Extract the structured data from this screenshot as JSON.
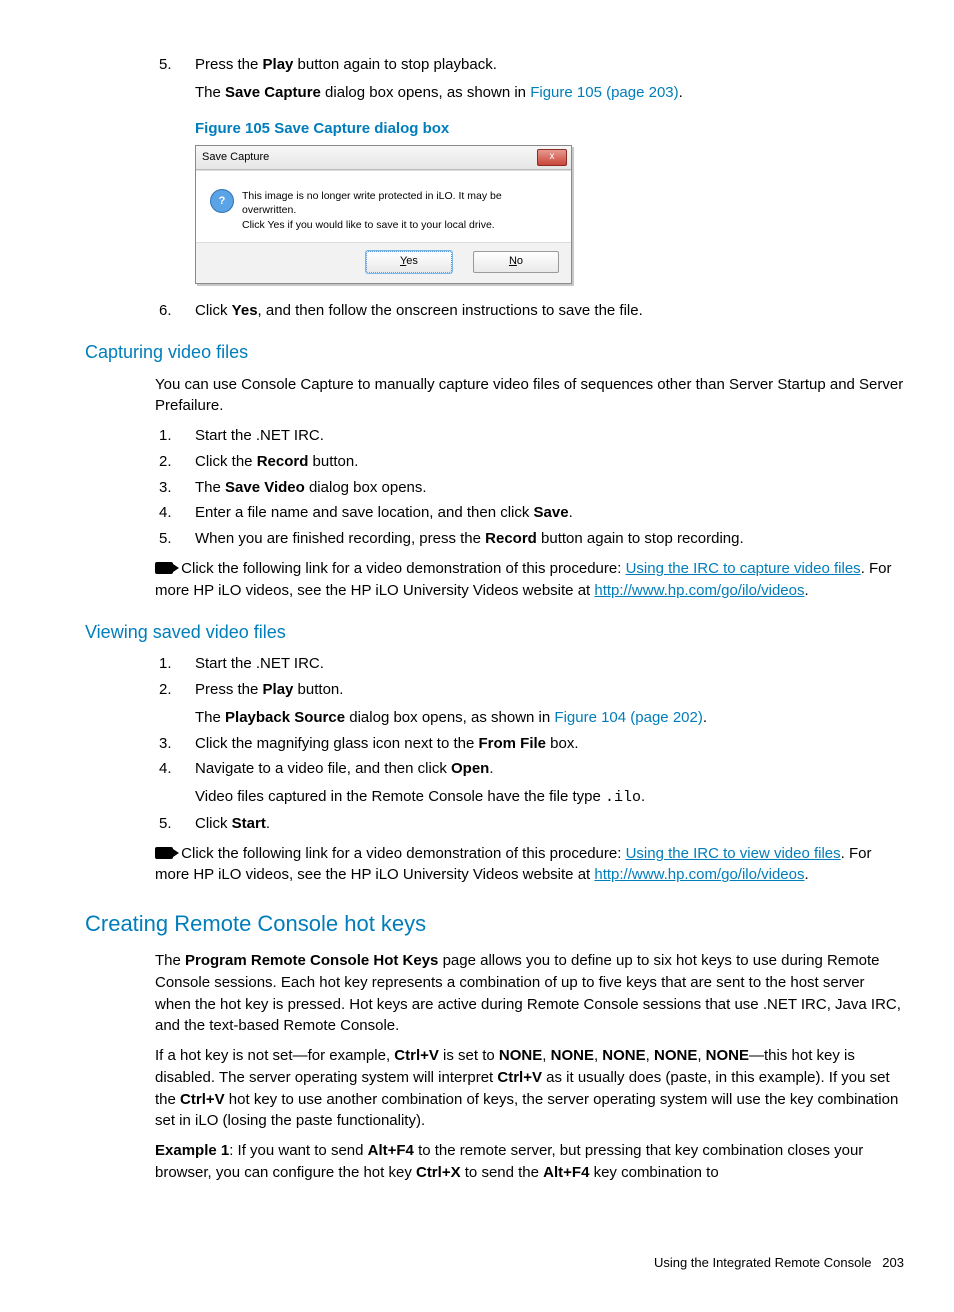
{
  "step5": {
    "num": "5.",
    "t1": "Press the ",
    "b1": "Play",
    "t2": " button again to stop playback.",
    "cont1": "The ",
    "cb1": "Save Capture",
    "cont2": " dialog box opens, as shown in ",
    "xref": "Figure 105 (page 203)",
    "dot": "."
  },
  "fig105_caption": "Figure 105 Save Capture dialog box",
  "dialog": {
    "title": "Save Capture",
    "msg1": "This image is no longer write protected in iLO. It may be overwritten.",
    "msg2": "Click Yes if you would like to save it to your local drive.",
    "yes_u": "Y",
    "yes_rest": "es",
    "no_u": "N",
    "no_rest": "o",
    "x": "x"
  },
  "step6": {
    "num": "6.",
    "t1": "Click ",
    "b1": "Yes",
    "t2": ", and then follow the onscreen instructions to save the file."
  },
  "h_capture": "Capturing video files",
  "cap_intro": "You can use Console Capture to manually capture video files of sequences other than Server Startup and Server Prefailure.",
  "cap_s1": {
    "num": "1.",
    "t": "Start the .NET IRC."
  },
  "cap_s2": {
    "num": "2.",
    "t1": "Click the ",
    "b": "Record",
    "t2": " button."
  },
  "cap_s3": {
    "num": "3.",
    "t1": "The ",
    "b": "Save Video",
    "t2": " dialog box opens."
  },
  "cap_s4": {
    "num": "4.",
    "t1": "Enter a file name and save location, and then click ",
    "b": "Save",
    "t2": "."
  },
  "cap_s5": {
    "num": "5.",
    "t1": "When you are finished recording, press the ",
    "b": "Record",
    "t2": " button again to stop recording."
  },
  "cap_video": {
    "pre": " Click the following link for a video demonstration of this procedure: ",
    "link1": "Using the IRC to capture video files",
    "mid": ". For more HP iLO videos, see the HP iLO University Videos website at ",
    "link2a": "http://",
    "link2b": "www.hp.com/go/ilo/videos",
    "dot": "."
  },
  "h_view": "Viewing saved video files",
  "view_s1": {
    "num": "1.",
    "t": "Start the .NET IRC."
  },
  "view_s2": {
    "num": "2.",
    "t1": "Press the ",
    "b": "Play",
    "t2": " button.",
    "cont1": "The ",
    "cb": "Playback Source",
    "cont2": " dialog box opens, as shown in ",
    "xref": "Figure 104 (page 202)",
    "dot": "."
  },
  "view_s3": {
    "num": "3.",
    "t1": "Click the magnifying glass icon next to the ",
    "b": "From File",
    "t2": " box."
  },
  "view_s4": {
    "num": "4.",
    "t1": "Navigate to a video file, and then click ",
    "b": "Open",
    "t2": ".",
    "cont": "Video files captured in the Remote Console have the file type ",
    "mono": ".ilo",
    "dot": "."
  },
  "view_s5": {
    "num": "5.",
    "t1": "Click ",
    "b": "Start",
    "t2": "."
  },
  "view_video": {
    "pre": " Click the following link for a video demonstration of this procedure: ",
    "link1": "Using the IRC to view video files",
    "mid": ". For more HP iLO videos, see the HP iLO University Videos website at ",
    "link2a": "http://",
    "link2b": "www.hp.com/go/ilo/videos",
    "dot": "."
  },
  "h_hotkeys": "Creating Remote Console hot keys",
  "hk_p1": {
    "t1": "The ",
    "b1": "Program Remote Console Hot Keys",
    "t2": " page allows you to define up to six hot keys to use during Remote Console sessions. Each hot key represents a combination of up to five keys that are sent to the host server when the hot key is pressed. Hot keys are active during Remote Console sessions that use .NET IRC, Java IRC, and the text-based Remote Console."
  },
  "hk_p2": {
    "t1": "If a hot key is not set—for example, ",
    "b1": "Ctrl+V",
    "t2": " is set to ",
    "n1": "NONE",
    "c": ", ",
    "n2": "NONE",
    "n3": "NONE",
    "n4": "NONE",
    "n5": "NONE",
    "t3": "—this hot key is disabled. The server operating system will interpret ",
    "b2": "Ctrl+V",
    "t4": " as it usually does (paste, in this example). If you set the ",
    "b3": "Ctrl+V",
    "t5": " hot key to use another combination of keys, the server operating system will use the key combination set in iLO (losing the paste functionality)."
  },
  "hk_p3": {
    "b1": "Example 1",
    "t1": ": If you want to send ",
    "b2": "Alt+F4",
    "t2": " to the remote server, but pressing that key combination closes your browser, you can configure the hot key ",
    "b3": "Ctrl+X",
    "t3": " to send the ",
    "b4": "Alt+F4",
    "t4": " key combination to"
  },
  "footer": {
    "label": "Using the Integrated Remote Console",
    "page": "203"
  }
}
